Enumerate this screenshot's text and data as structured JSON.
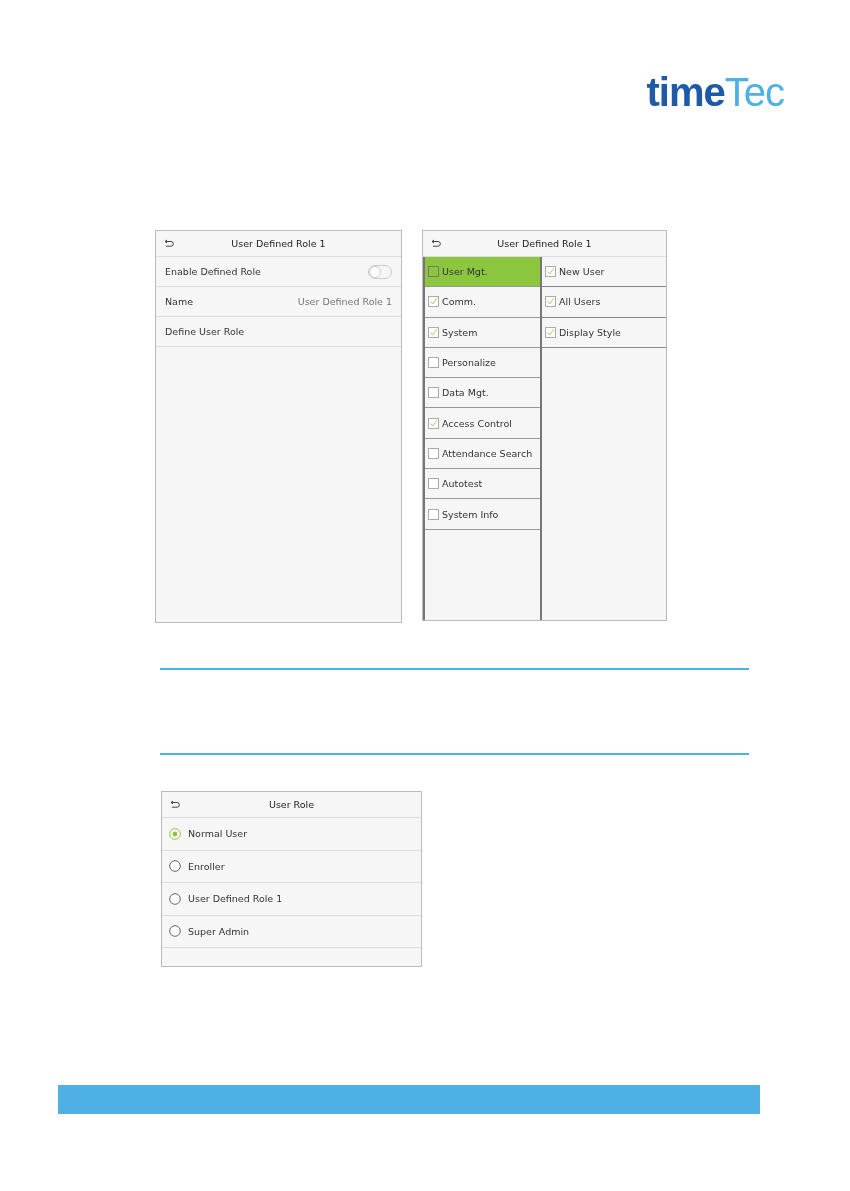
{
  "logo": {
    "primary": "time",
    "accent": "Tec"
  },
  "screens": [
    {
      "kind": "settings",
      "title": "User Defined Role 1",
      "rows": [
        {
          "kind": "toggle",
          "label": "Enable Defined Role",
          "on": false
        },
        {
          "kind": "value",
          "label": "Name",
          "value": "User Defined Role 1"
        },
        {
          "kind": "link",
          "label": "Define User Role"
        }
      ]
    },
    {
      "kind": "permissions",
      "title": "User Defined Role 1",
      "categories": [
        {
          "label": "User Mgt.",
          "checked": false,
          "selected": true
        },
        {
          "label": "Comm.",
          "checked": true,
          "selected": false
        },
        {
          "label": "System",
          "checked": true,
          "selected": false
        },
        {
          "label": "Personalize",
          "checked": false,
          "selected": false
        },
        {
          "label": "Data Mgt.",
          "checked": false,
          "selected": false
        },
        {
          "label": "Access Control",
          "checked": true,
          "selected": false
        },
        {
          "label": "Attendance Search",
          "checked": false,
          "selected": false
        },
        {
          "label": "Autotest",
          "checked": false,
          "selected": false
        },
        {
          "label": "System Info",
          "checked": false,
          "selected": false
        }
      ],
      "items": [
        {
          "label": "New User",
          "checked": true
        },
        {
          "label": "All Users",
          "checked": true
        },
        {
          "label": "Display Style",
          "checked": true
        }
      ]
    },
    {
      "kind": "radio",
      "title": "User Role",
      "options": [
        {
          "label": "Normal User",
          "selected": true
        },
        {
          "label": "Enroller",
          "selected": false
        },
        {
          "label": "User Defined Role 1",
          "selected": false
        },
        {
          "label": "Super Admin",
          "selected": false
        }
      ]
    }
  ]
}
